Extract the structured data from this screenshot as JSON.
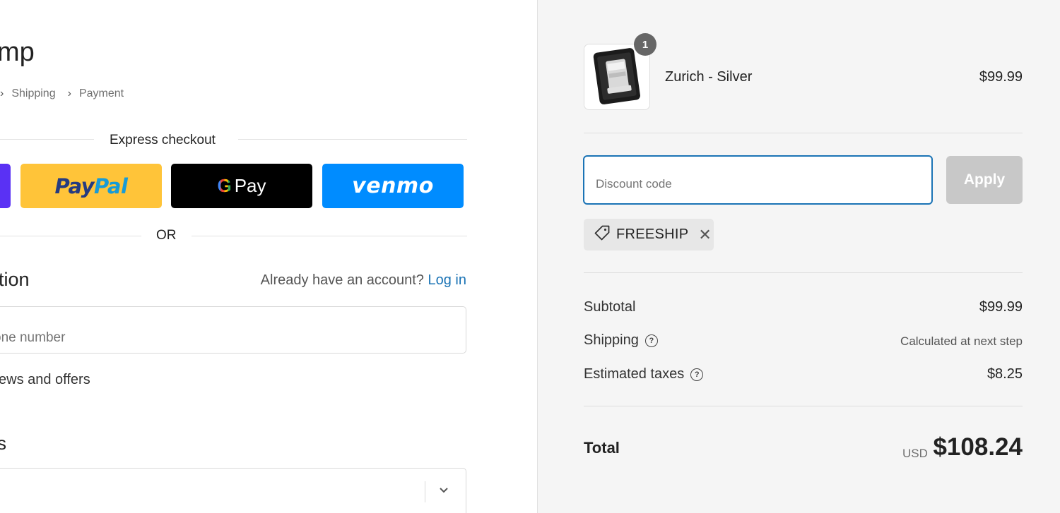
{
  "store": {
    "name": "mp"
  },
  "breadcrumbs": {
    "shipping": "Shipping",
    "payment": "Payment"
  },
  "express": {
    "label": "Express checkout",
    "paypal_a": "Pay",
    "paypal_b": "Pal",
    "gpay_g": "G",
    "gpay_text": "Pay",
    "venmo": "venmo"
  },
  "or_label": "OR",
  "contact": {
    "heading": "tion",
    "account_prompt": "Already have an account?",
    "login": "Log in",
    "phone_placeholder": "one number",
    "news_label": "ews and offers"
  },
  "address": {
    "heading": "s",
    "chevron": "⌄"
  },
  "order": {
    "qty": "1",
    "product_name": "Zurich - Silver",
    "product_price": "$99.99",
    "discount_placeholder": "Discount code",
    "apply_label": "Apply",
    "tag_code": "FREESHIP",
    "tag_remove": "✕",
    "subtotal_label": "Subtotal",
    "subtotal_value": "$99.99",
    "shipping_label": "Shipping",
    "shipping_value": "Calculated at next step",
    "taxes_label": "Estimated taxes",
    "taxes_value": "$8.25",
    "total_label": "Total",
    "currency": "USD",
    "total_value": "$108.24",
    "help_glyph": "?"
  },
  "colors": {
    "paypal_bg": "#ffc439",
    "gpay_bg": "#000000",
    "venmo_bg": "#008cff",
    "shop_bg": "#5a31f4",
    "link": "#1a73b5",
    "focus_border": "#1a73b5",
    "apply_disabled": "#c8c8c8"
  }
}
